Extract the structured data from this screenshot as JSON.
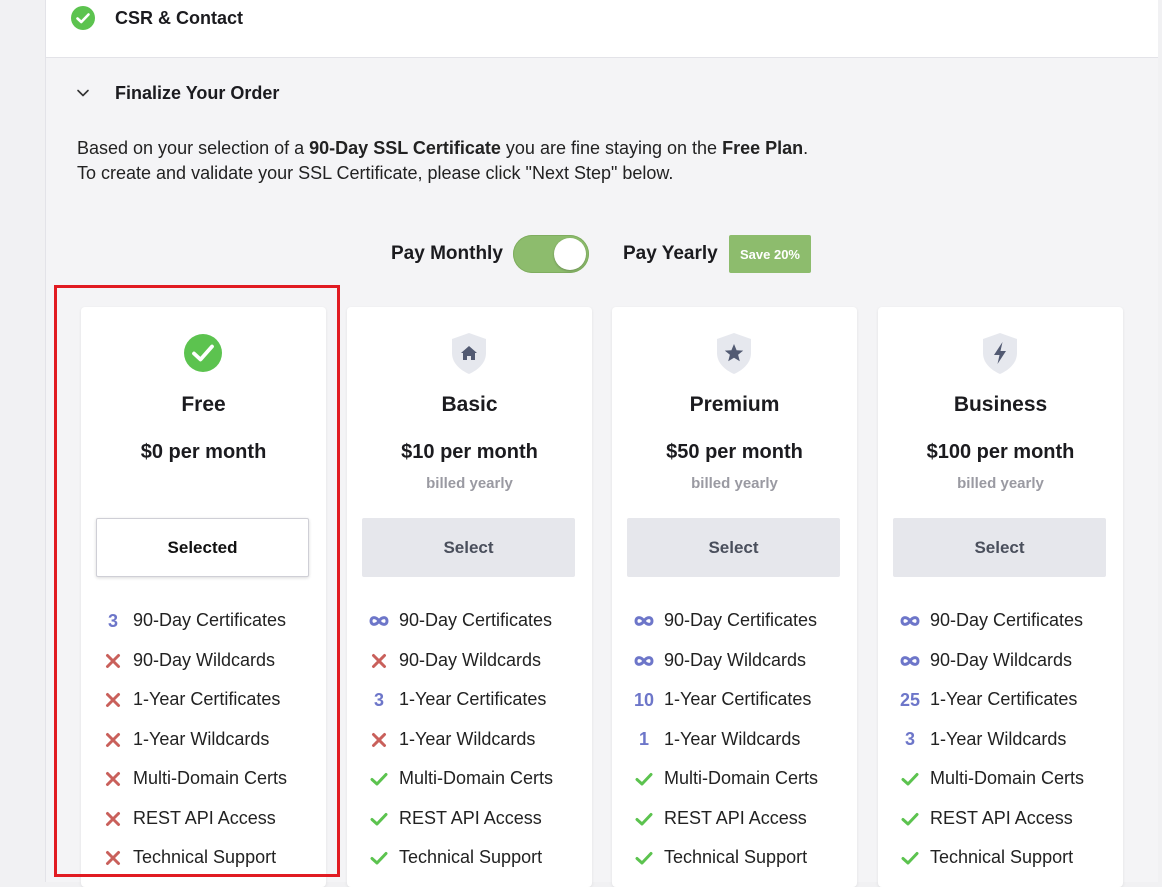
{
  "steps": {
    "done_title": "CSR & Contact",
    "current_title": "Finalize Your Order"
  },
  "description": {
    "line1_a": "Based on your selection of a ",
    "line1_b": "90-Day SSL Certificate",
    "line1_c": " you are fine staying on the ",
    "line1_d": "Free Plan",
    "line1_e": ".",
    "line2": "To create and validate your SSL Certificate, please click \"Next Step\" below."
  },
  "billing_toggle": {
    "monthly_label": "Pay Monthly",
    "yearly_label": "Pay Yearly",
    "save_badge": "Save 20%",
    "state": "yearly"
  },
  "colors": {
    "accent_green": "#8dbc6d",
    "check_green": "#5cc34f",
    "cross_red": "#c9605b",
    "count_purple": "#6d76c9",
    "highlight_red": "#e11b22"
  },
  "plans": [
    {
      "name": "Free",
      "price": "$0 per month",
      "billing": "",
      "button": "Selected",
      "selected": true,
      "icon": "check-circle-icon",
      "features": [
        {
          "mark": "3",
          "label": "90-Day Certificates"
        },
        {
          "mark": "x",
          "label": "90-Day Wildcards"
        },
        {
          "mark": "x",
          "label": "1-Year Certificates"
        },
        {
          "mark": "x",
          "label": "1-Year Wildcards"
        },
        {
          "mark": "x",
          "label": "Multi-Domain Certs"
        },
        {
          "mark": "x",
          "label": "REST API Access"
        },
        {
          "mark": "x",
          "label": "Technical Support"
        }
      ]
    },
    {
      "name": "Basic",
      "price": "$10 per month",
      "billing": "billed yearly",
      "button": "Select",
      "selected": false,
      "icon": "shield-home-icon",
      "features": [
        {
          "mark": "inf",
          "label": "90-Day Certificates"
        },
        {
          "mark": "x",
          "label": "90-Day Wildcards"
        },
        {
          "mark": "3",
          "label": "1-Year Certificates"
        },
        {
          "mark": "x",
          "label": "1-Year Wildcards"
        },
        {
          "mark": "check",
          "label": "Multi-Domain Certs"
        },
        {
          "mark": "check",
          "label": "REST API Access"
        },
        {
          "mark": "check",
          "label": "Technical Support"
        }
      ]
    },
    {
      "name": "Premium",
      "price": "$50 per month",
      "billing": "billed yearly",
      "button": "Select",
      "selected": false,
      "icon": "shield-star-icon",
      "features": [
        {
          "mark": "inf",
          "label": "90-Day Certificates"
        },
        {
          "mark": "inf",
          "label": "90-Day Wildcards"
        },
        {
          "mark": "10",
          "label": "1-Year Certificates"
        },
        {
          "mark": "1",
          "label": "1-Year Wildcards"
        },
        {
          "mark": "check",
          "label": "Multi-Domain Certs"
        },
        {
          "mark": "check",
          "label": "REST API Access"
        },
        {
          "mark": "check",
          "label": "Technical Support"
        }
      ]
    },
    {
      "name": "Business",
      "price": "$100 per month",
      "billing": "billed yearly",
      "button": "Select",
      "selected": false,
      "icon": "shield-bolt-icon",
      "features": [
        {
          "mark": "inf",
          "label": "90-Day Certificates"
        },
        {
          "mark": "inf",
          "label": "90-Day Wildcards"
        },
        {
          "mark": "25",
          "label": "1-Year Certificates"
        },
        {
          "mark": "3",
          "label": "1-Year Wildcards"
        },
        {
          "mark": "check",
          "label": "Multi-Domain Certs"
        },
        {
          "mark": "check",
          "label": "REST API Access"
        },
        {
          "mark": "check",
          "label": "Technical Support"
        }
      ]
    }
  ]
}
